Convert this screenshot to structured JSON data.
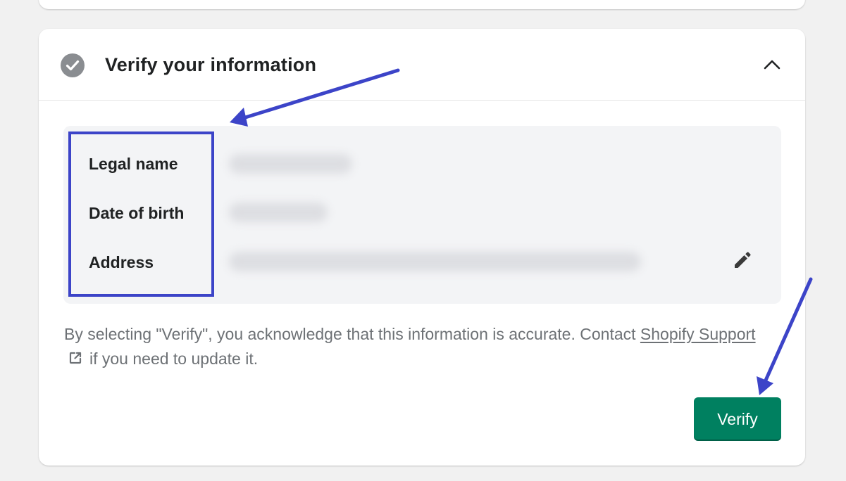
{
  "section": {
    "title": "Verify your information"
  },
  "info": {
    "rows": [
      {
        "label": "Legal name"
      },
      {
        "label": "Date of birth"
      },
      {
        "label": "Address"
      }
    ]
  },
  "disclaimer": {
    "text_before": "By selecting \"Verify\", you acknowledge that this information is accurate. Contact ",
    "link_text": "Shopify Support",
    "text_after": "if you need to update it."
  },
  "actions": {
    "verify_label": "Verify"
  },
  "icons": {
    "status": "check-circle-icon",
    "collapse": "chevron-up-icon",
    "edit": "pencil-icon",
    "external": "external-link-icon"
  },
  "colors": {
    "primary": "#008060",
    "annotation": "#3c44c8",
    "check_icon": "#8a8d91",
    "info_box_bg": "#f3f4f6"
  }
}
